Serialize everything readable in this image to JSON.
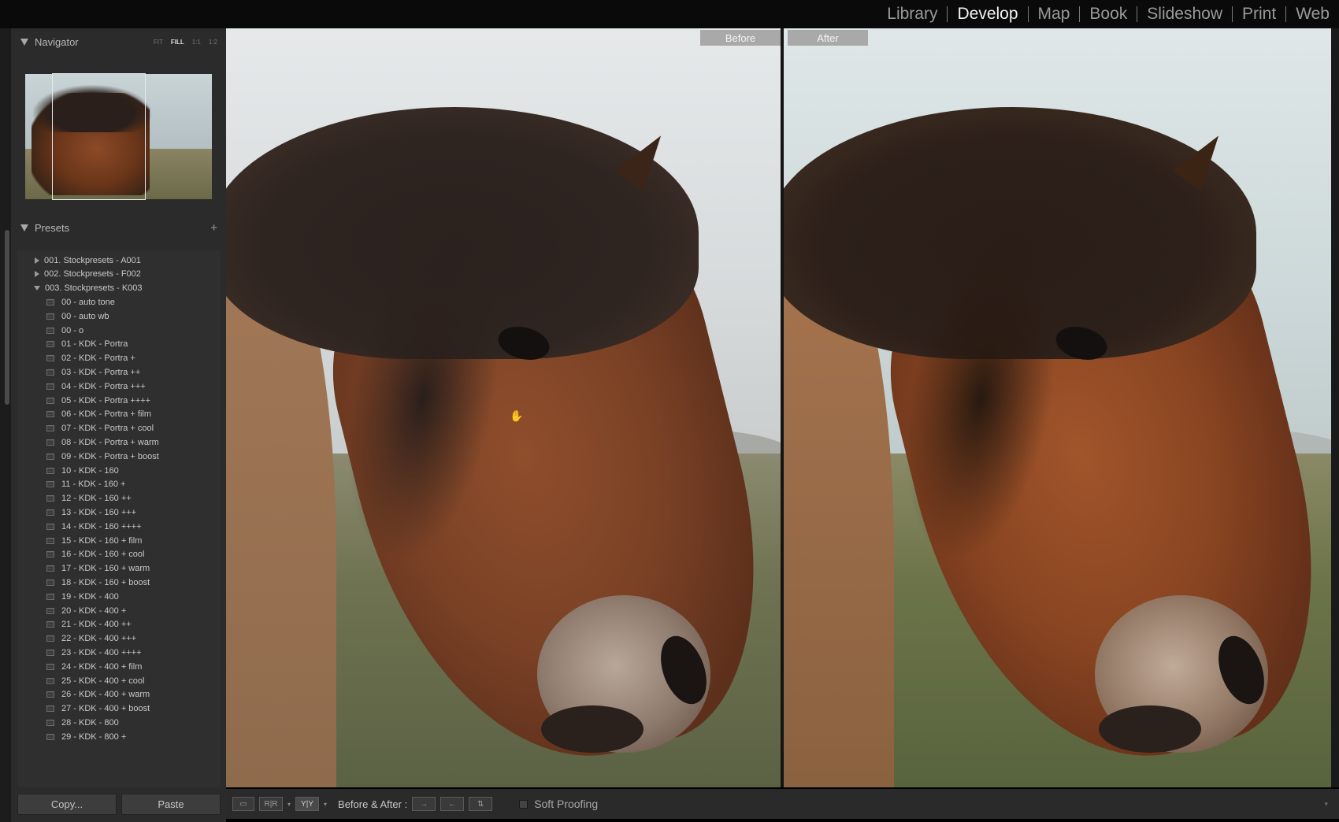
{
  "modules": [
    {
      "label": "Library",
      "active": false
    },
    {
      "label": "Develop",
      "active": true
    },
    {
      "label": "Map",
      "active": false
    },
    {
      "label": "Book",
      "active": false
    },
    {
      "label": "Slideshow",
      "active": false
    },
    {
      "label": "Print",
      "active": false
    },
    {
      "label": "Web",
      "active": false
    }
  ],
  "navigator": {
    "title": "Navigator",
    "options": [
      "FIT",
      "FILL",
      "1:1",
      "1:2"
    ],
    "selected_option": "FILL"
  },
  "presets": {
    "title": "Presets",
    "add_label": "+",
    "folders": [
      {
        "label": "001. Stockpresets - A001",
        "expanded": false
      },
      {
        "label": "002. Stockpresets - F002",
        "expanded": false
      },
      {
        "label": "003. Stockpresets - K003",
        "expanded": true
      }
    ],
    "items": [
      "00 - auto tone",
      "00 - auto wb",
      "00 - o",
      "01 - KDK - Portra",
      "02 - KDK - Portra +",
      "03 - KDK - Portra ++",
      "04 - KDK - Portra +++",
      "05 - KDK - Portra ++++",
      "06 - KDK - Portra + film",
      "07 - KDK - Portra + cool",
      "08 - KDK - Portra + warm",
      "09 - KDK - Portra + boost",
      "10 - KDK - 160",
      "11 - KDK - 160 +",
      "12 - KDK - 160 ++",
      "13 - KDK - 160 +++",
      "14 - KDK - 160 ++++",
      "15 - KDK - 160 + film",
      "16 - KDK - 160 + cool",
      "17 - KDK - 160 + warm",
      "18 - KDK - 160 + boost",
      "19 - KDK - 400",
      "20 - KDK - 400 +",
      "21 - KDK - 400 ++",
      "22 - KDK - 400 +++",
      "23 - KDK - 400 ++++",
      "24 - KDK - 400 + film",
      "25 - KDK - 400 + cool",
      "26 - KDK - 400 + warm",
      "27 - KDK - 400 + boost",
      "28 - KDK - 800",
      "29 - KDK - 800 +"
    ]
  },
  "buttons": {
    "copy": "Copy...",
    "paste": "Paste"
  },
  "view": {
    "before_label": "Before",
    "after_label": "After"
  },
  "toolbar": {
    "view_buttons": [
      "▭",
      "R|R",
      "Y|Y"
    ],
    "before_after_label": "Before & After :",
    "swap_buttons": [
      "→",
      "←",
      "⇅"
    ],
    "soft_proofing_label": "Soft Proofing",
    "soft_proofing_checked": false,
    "caret": "▾"
  },
  "colors": {
    "panel_bg": "#2b2b2b",
    "top_bar": "#0a0a0a",
    "active_module": "#f2f2f2",
    "inactive_module": "#9a9a9a"
  }
}
